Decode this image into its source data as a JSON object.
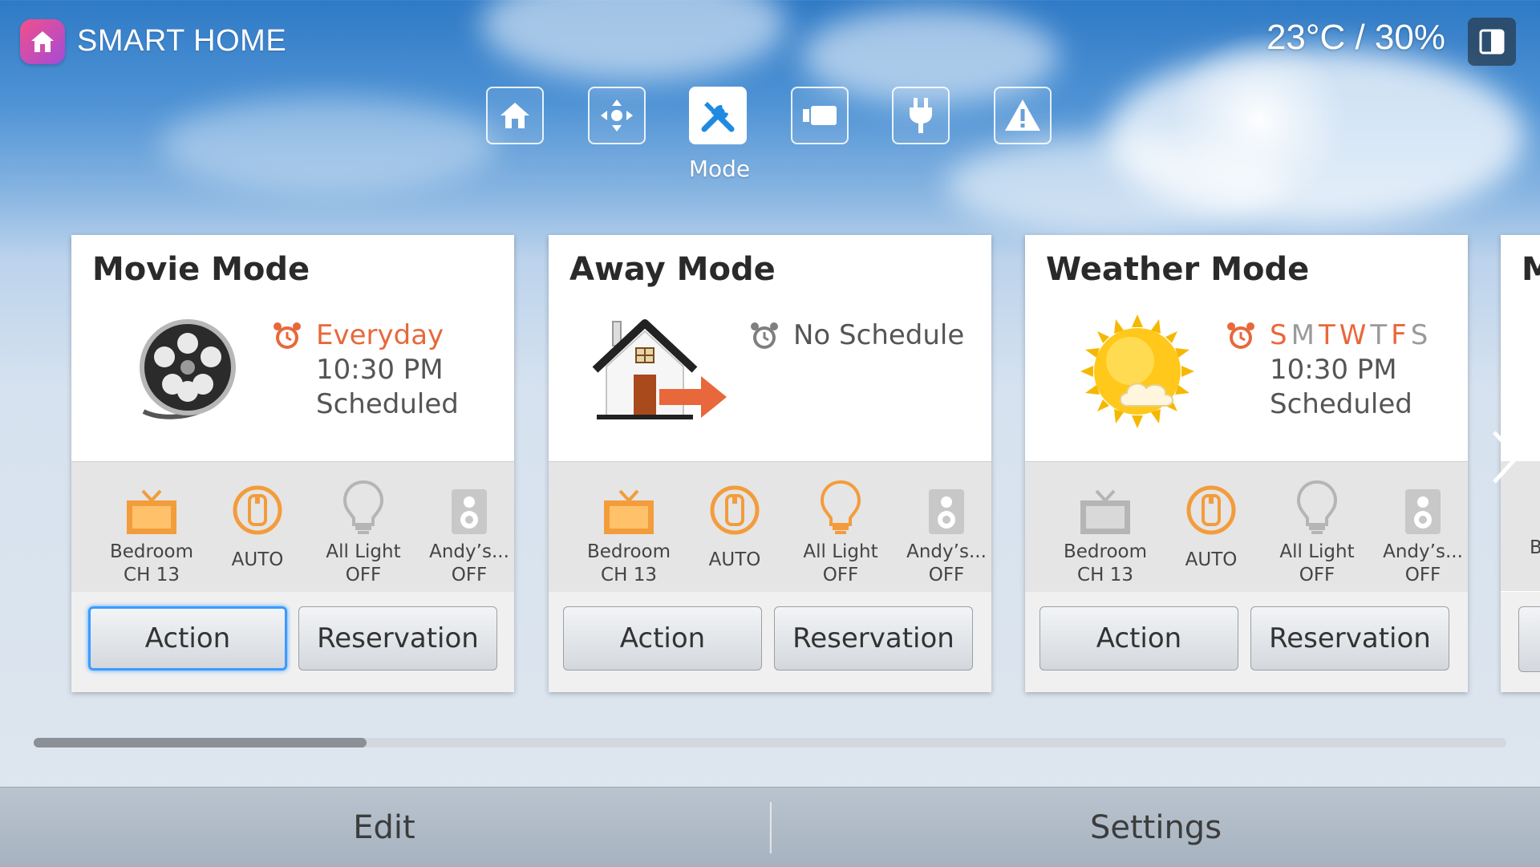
{
  "header": {
    "app_title": "SMART HOME",
    "climate": "23°C / 30%"
  },
  "nav": {
    "items": [
      {
        "icon": "home-icon",
        "label": ""
      },
      {
        "icon": "move-arrows-icon",
        "label": ""
      },
      {
        "icon": "tools-icon",
        "label": "Mode",
        "active": true
      },
      {
        "icon": "camera-icon",
        "label": ""
      },
      {
        "icon": "plug-icon",
        "label": ""
      },
      {
        "icon": "warning-icon",
        "label": ""
      }
    ]
  },
  "cards": [
    {
      "title": "Movie Mode",
      "illustration": "film-reel-icon",
      "schedule": {
        "line1": "Everyday",
        "line2": "10:30 PM",
        "line3": "Scheduled"
      },
      "devices": [
        {
          "line1": "Bedroom",
          "line2": "CH 13"
        },
        {
          "line1": "AUTO"
        },
        {
          "line1": "All Light",
          "line2": "OFF"
        },
        {
          "line1": "Andy’s...",
          "line2": "OFF"
        }
      ],
      "buttons": {
        "action": "Action",
        "reservation": "Reservation"
      }
    },
    {
      "title": "Away Mode",
      "illustration": "house-exit-icon",
      "schedule": {
        "line1": "No Schedule"
      },
      "devices": [
        {
          "line1": "Bedroom",
          "line2": "CH 13"
        },
        {
          "line1": "AUTO"
        },
        {
          "line1": "All Light",
          "line2": "OFF"
        },
        {
          "line1": "Andy’s...",
          "line2": "OFF"
        }
      ],
      "buttons": {
        "action": "Action",
        "reservation": "Reservation"
      }
    },
    {
      "title": "Weather Mode",
      "illustration": "sun-cloud-icon",
      "schedule": {
        "days": [
          "S",
          "M",
          "T",
          "W",
          "T",
          "F",
          "S"
        ],
        "line2": "10:30 PM",
        "line3": "Scheduled"
      },
      "devices": [
        {
          "line1": "Bedroom",
          "line2": "CH 13"
        },
        {
          "line1": "AUTO"
        },
        {
          "line1": "All Light",
          "line2": "OFF"
        },
        {
          "line1": "Andy’s...",
          "line2": "OFF"
        }
      ],
      "buttons": {
        "action": "Action",
        "reservation": "Reservation"
      }
    }
  ],
  "peek_card": {
    "title": "M",
    "device": "B"
  },
  "scroll": {
    "position": 0.2
  },
  "bottom": {
    "edit": "Edit",
    "settings": "Settings"
  },
  "colors": {
    "accent_orange": "#e8683b",
    "focus_blue": "#3b9bff",
    "icon_orange": "#f39c3c",
    "icon_gray": "#b5b5b5"
  }
}
